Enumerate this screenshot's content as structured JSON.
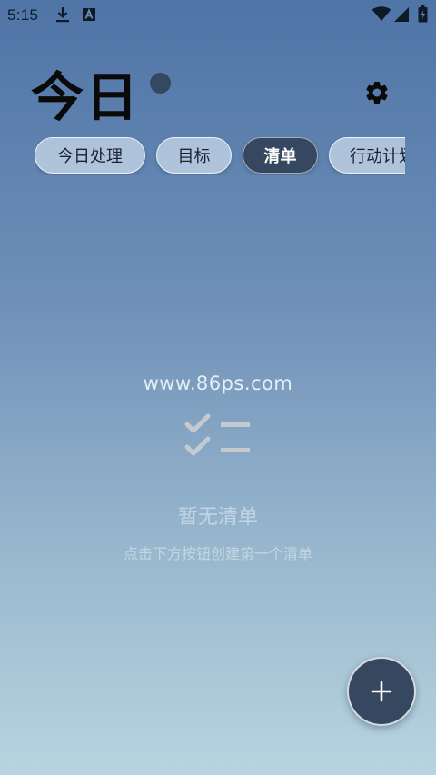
{
  "status_bar": {
    "time": "5:15",
    "icons": [
      "download-icon",
      "font-a-icon",
      "wifi-icon",
      "signal-icon",
      "battery-icon"
    ]
  },
  "header": {
    "title": "今日",
    "status_dot_color": "#354761",
    "settings_icon": "gear-icon"
  },
  "tabs": [
    {
      "label": "今日处理",
      "active": false
    },
    {
      "label": "目标",
      "active": false
    },
    {
      "label": "清单",
      "active": true
    },
    {
      "label": "行动计划",
      "active": false
    }
  ],
  "watermark": "www.86ps.com",
  "empty_state": {
    "icon": "checklist-icon",
    "title": "暂无清单",
    "subtitle": "点击下方按钮创建第一个清单"
  },
  "fab": {
    "icon": "plus-icon"
  },
  "colors": {
    "accent": "#36485f",
    "gradient_top": "#4f74a6",
    "gradient_bottom": "#b8d4e0"
  }
}
